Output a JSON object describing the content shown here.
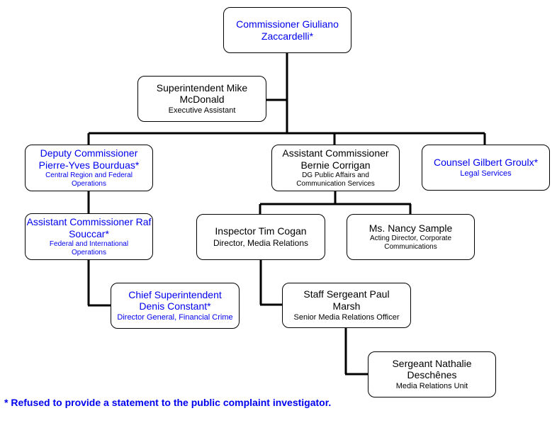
{
  "nodes": {
    "commissioner": {
      "name": "Commissioner Giuliano Zaccardelli*",
      "role": "",
      "refused": true
    },
    "exec_assistant": {
      "name": "Superintendent Mike McDonald",
      "role": "Executive Assistant",
      "refused": false
    },
    "deputy": {
      "name": "Deputy Commissioner Pierre-Yves Bourduas*",
      "role": "Central Region and Federal Operations",
      "refused": true
    },
    "ac_corrigan": {
      "name": "Assistant Commissioner Bernie Corrigan",
      "role": "DG Public Affairs and Communication Services",
      "refused": false
    },
    "counsel": {
      "name": "Counsel Gilbert Groulx*",
      "role": "Legal Services",
      "refused": true
    },
    "ac_souccar": {
      "name": "Assistant Commissioner Raf Souccar*",
      "role": "Federal and International Operations",
      "refused": true
    },
    "cogan": {
      "name": "Inspector Tim Cogan",
      "role": "Director, Media Relations",
      "refused": false
    },
    "sample": {
      "name": "Ms. Nancy Sample",
      "role": "Acting Director, Corporate Communications",
      "refused": false
    },
    "constant": {
      "name": "Chief Superintendent Denis Constant*",
      "role": "Director General, Financial Crime",
      "refused": true
    },
    "marsh": {
      "name": "Staff Sergeant Paul Marsh",
      "role": "Senior Media Relations Officer",
      "refused": false
    },
    "deschenes": {
      "name": "Sergeant Nathalie Deschênes",
      "role": "Media Relations Unit",
      "refused": false
    }
  },
  "footnote": "* Refused to provide a statement to the public complaint investigator.",
  "colors": {
    "refused": "#0000ee",
    "default": "#000000",
    "connector": "#000000"
  }
}
